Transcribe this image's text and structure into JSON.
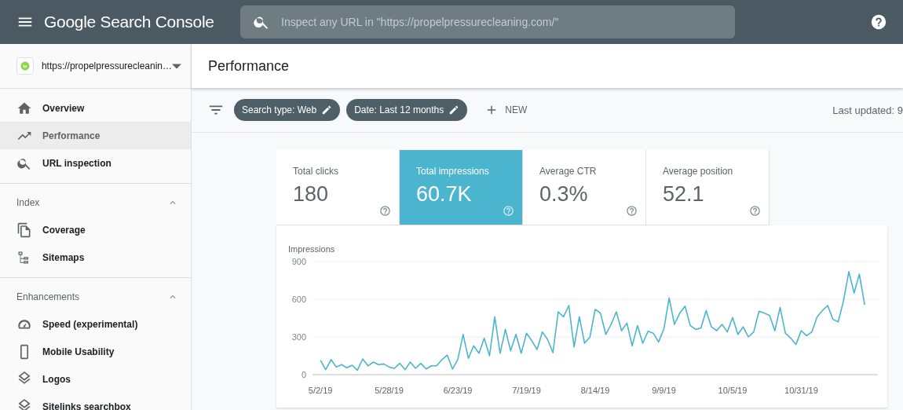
{
  "header": {
    "title": "Google Search Console",
    "search": {
      "placeholder": "Inspect any URL in \"https://propelpressurecleaning.com/\""
    }
  },
  "sidebar": {
    "property": "https://propelpressurecleanin…",
    "items": [
      {
        "label": "Overview",
        "selected": false
      },
      {
        "label": "Performance",
        "selected": true
      },
      {
        "label": "URL inspection",
        "selected": false
      }
    ],
    "sections": [
      {
        "title": "Index",
        "expanded": true,
        "items": [
          {
            "label": "Coverage",
            "selected": false
          },
          {
            "label": "Sitemaps",
            "selected": false
          }
        ]
      },
      {
        "title": "Enhancements",
        "expanded": true,
        "items": [
          {
            "label": "Speed (experimental)",
            "selected": false
          },
          {
            "label": "Mobile Usability",
            "selected": false
          },
          {
            "label": "Logos",
            "selected": false
          },
          {
            "label": "Sitelinks searchbox",
            "selected": false
          }
        ]
      }
    ]
  },
  "page": {
    "title": "Performance"
  },
  "filters": {
    "chips": [
      "Search type: Web",
      "Date: Last 12 months"
    ],
    "new_button": "NEW",
    "last_updated": "Last updated: 9"
  },
  "metrics": [
    {
      "label": "Total clicks",
      "value": "180",
      "selected": false
    },
    {
      "label": "Total impressions",
      "value": "60.7K",
      "selected": true
    },
    {
      "label": "Average CTR",
      "value": "0.3%",
      "selected": false
    },
    {
      "label": "Average position",
      "value": "52.1",
      "selected": false
    }
  ],
  "chart": {
    "chart_data": {
      "type": "line",
      "ylim": [
        0,
        900
      ],
      "yticks": [
        0,
        300,
        600,
        900
      ],
      "categories": [
        "5/2/19",
        null,
        null,
        null,
        null,
        null,
        null,
        null,
        null,
        null,
        null,
        null,
        null,
        "5/28/19",
        null,
        null,
        null,
        null,
        null,
        null,
        null,
        null,
        null,
        null,
        null,
        null,
        "6/23/19",
        null,
        null,
        null,
        null,
        null,
        null,
        null,
        null,
        null,
        null,
        null,
        null,
        "7/19/19",
        null,
        null,
        null,
        null,
        null,
        null,
        null,
        null,
        null,
        null,
        null,
        null,
        "8/14/19",
        null,
        null,
        null,
        null,
        null,
        null,
        null,
        null,
        null,
        null,
        null,
        null,
        "9/9/19",
        null,
        null,
        null,
        null,
        null,
        null,
        null,
        null,
        null,
        null,
        null,
        null,
        "10/5/19",
        null,
        null,
        null,
        null,
        null,
        null,
        null,
        null,
        null,
        null,
        null,
        null,
        "10/31/19",
        null,
        null,
        null,
        null,
        null,
        null,
        null,
        null,
        null,
        null,
        null,
        null
      ],
      "series": [
        {
          "name": "Impressions",
          "color": "#4bb5cf",
          "values": [
            115,
            40,
            120,
            60,
            80,
            55,
            75,
            35,
            125,
            70,
            100,
            80,
            85,
            60,
            50,
            90,
            40,
            100,
            50,
            90,
            45,
            70,
            70,
            120,
            155,
            45,
            120,
            320,
            130,
            230,
            170,
            290,
            150,
            460,
            170,
            360,
            190,
            320,
            170,
            330,
            270,
            200,
            340,
            280,
            175,
            500,
            460,
            550,
            220,
            460,
            250,
            300,
            520,
            490,
            320,
            400,
            500,
            350,
            410,
            230,
            390,
            250,
            345,
            330,
            260,
            365,
            610,
            400,
            490,
            545,
            390,
            360,
            370,
            510,
            380,
            350,
            400,
            340,
            455,
            320,
            380,
            300,
            340,
            505,
            490,
            470,
            350,
            535,
            330,
            290,
            240,
            350,
            310,
            340,
            460,
            510,
            550,
            440,
            420,
            590,
            820,
            650,
            800,
            555
          ]
        }
      ]
    }
  }
}
